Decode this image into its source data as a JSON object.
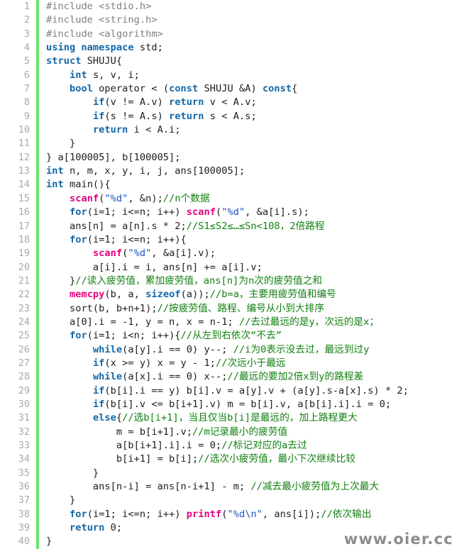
{
  "viewer": {
    "title": "C++ source code listing",
    "language": "C++",
    "total_lines": 40,
    "first_line_number": 1,
    "gutter_marker_color": "#6ae26a",
    "background_color": "#ffffff",
    "line_number_color": "#a9a9a9"
  },
  "theme": {
    "plain": "#202020",
    "preprocessor": "#808080",
    "keyword": "#1367a7",
    "type": "#808080",
    "function": "#e5007f",
    "string": "#1e55c8",
    "comment": "#128012",
    "watermark": "#8c8c8c"
  },
  "watermark": {
    "text": "www.oier.cc"
  },
  "lines": [
    {
      "n": "1",
      "tokens": [
        {
          "t": "pre",
          "x": "#include <stdio.h>"
        }
      ]
    },
    {
      "n": "2",
      "tokens": [
        {
          "t": "pre",
          "x": "#include <string.h>"
        }
      ]
    },
    {
      "n": "3",
      "tokens": [
        {
          "t": "pre",
          "x": "#include <algorithm>"
        }
      ]
    },
    {
      "n": "4",
      "tokens": [
        {
          "t": "kw",
          "x": "using namespace"
        },
        {
          "t": "plain",
          "x": " std;"
        }
      ]
    },
    {
      "n": "5",
      "tokens": [
        {
          "t": "kw",
          "x": "struct"
        },
        {
          "t": "plain",
          "x": " SHUJU{"
        }
      ]
    },
    {
      "n": "6",
      "tokens": [
        {
          "t": "plain",
          "x": "    "
        },
        {
          "t": "kw",
          "x": "int"
        },
        {
          "t": "plain",
          "x": " s, v, i;"
        }
      ]
    },
    {
      "n": "7",
      "tokens": [
        {
          "t": "plain",
          "x": "    "
        },
        {
          "t": "kw",
          "x": "bool"
        },
        {
          "t": "plain",
          "x": " operator < ("
        },
        {
          "t": "kw",
          "x": "const"
        },
        {
          "t": "plain",
          "x": " SHUJU &A) "
        },
        {
          "t": "kw",
          "x": "const"
        },
        {
          "t": "plain",
          "x": "{"
        }
      ]
    },
    {
      "n": "8",
      "tokens": [
        {
          "t": "plain",
          "x": "        "
        },
        {
          "t": "kw",
          "x": "if"
        },
        {
          "t": "plain",
          "x": "(v != A.v) "
        },
        {
          "t": "kw",
          "x": "return"
        },
        {
          "t": "plain",
          "x": " v < A.v;"
        }
      ]
    },
    {
      "n": "9",
      "tokens": [
        {
          "t": "plain",
          "x": "        "
        },
        {
          "t": "kw",
          "x": "if"
        },
        {
          "t": "plain",
          "x": "(s != A.s) "
        },
        {
          "t": "kw",
          "x": "return"
        },
        {
          "t": "plain",
          "x": " s < A.s;"
        }
      ]
    },
    {
      "n": "10",
      "tokens": [
        {
          "t": "plain",
          "x": "        "
        },
        {
          "t": "kw",
          "x": "return"
        },
        {
          "t": "plain",
          "x": " i < A.i;"
        }
      ]
    },
    {
      "n": "11",
      "tokens": [
        {
          "t": "plain",
          "x": "    }"
        }
      ]
    },
    {
      "n": "12",
      "tokens": [
        {
          "t": "plain",
          "x": "} a[100005], b[100005];"
        }
      ]
    },
    {
      "n": "13",
      "tokens": [
        {
          "t": "kw",
          "x": "int"
        },
        {
          "t": "plain",
          "x": " n, m, x, y, i, j, ans[100005];"
        }
      ]
    },
    {
      "n": "14",
      "tokens": [
        {
          "t": "kw",
          "x": "int"
        },
        {
          "t": "plain",
          "x": " main(){"
        }
      ]
    },
    {
      "n": "15",
      "tokens": [
        {
          "t": "plain",
          "x": "    "
        },
        {
          "t": "fn",
          "x": "scanf"
        },
        {
          "t": "plain",
          "x": "("
        },
        {
          "t": "str",
          "x": "\"%d\""
        },
        {
          "t": "plain",
          "x": ", &n);"
        },
        {
          "t": "com",
          "x": "//n个数据"
        }
      ]
    },
    {
      "n": "16",
      "tokens": [
        {
          "t": "plain",
          "x": "    "
        },
        {
          "t": "kw",
          "x": "for"
        },
        {
          "t": "plain",
          "x": "(i=1; i<=n; i++) "
        },
        {
          "t": "fn",
          "x": "scanf"
        },
        {
          "t": "plain",
          "x": "("
        },
        {
          "t": "str",
          "x": "\"%d\""
        },
        {
          "t": "plain",
          "x": ", &a[i].s);"
        }
      ]
    },
    {
      "n": "17",
      "tokens": [
        {
          "t": "plain",
          "x": "    ans[n] = a[n].s * 2;"
        },
        {
          "t": "com",
          "x": "//S1≤S2≤…≤Sn<108，2倍路程"
        }
      ]
    },
    {
      "n": "18",
      "tokens": [
        {
          "t": "plain",
          "x": "    "
        },
        {
          "t": "kw",
          "x": "for"
        },
        {
          "t": "plain",
          "x": "(i=1; i<=n; i++){"
        }
      ]
    },
    {
      "n": "19",
      "tokens": [
        {
          "t": "plain",
          "x": "        "
        },
        {
          "t": "fn",
          "x": "scanf"
        },
        {
          "t": "plain",
          "x": "("
        },
        {
          "t": "str",
          "x": "\"%d\""
        },
        {
          "t": "plain",
          "x": ", &a[i].v);"
        }
      ]
    },
    {
      "n": "20",
      "tokens": [
        {
          "t": "plain",
          "x": "        a[i].i = i, ans[n] += a[i].v;"
        }
      ]
    },
    {
      "n": "21",
      "tokens": [
        {
          "t": "plain",
          "x": "    }"
        },
        {
          "t": "com",
          "x": "//读入疲劳值，累加疲劳值，ans[n]为n次的疲劳值之和"
        }
      ]
    },
    {
      "n": "22",
      "tokens": [
        {
          "t": "plain",
          "x": "    "
        },
        {
          "t": "fn",
          "x": "memcpy"
        },
        {
          "t": "plain",
          "x": "(b, a, "
        },
        {
          "t": "kw",
          "x": "sizeof"
        },
        {
          "t": "plain",
          "x": "(a));"
        },
        {
          "t": "com",
          "x": "//b=a，主要用疲劳值和编号"
        }
      ]
    },
    {
      "n": "23",
      "tokens": [
        {
          "t": "plain",
          "x": "    sort(b, b+n+1);"
        },
        {
          "t": "com",
          "x": "//按疲劳值、路程、编号从小到大排序"
        }
      ]
    },
    {
      "n": "24",
      "tokens": [
        {
          "t": "plain",
          "x": "    a[0].i = -1, y = n, x = n-1; "
        },
        {
          "t": "com",
          "x": "//去过最远的是y，次远的是x；"
        }
      ]
    },
    {
      "n": "25",
      "tokens": [
        {
          "t": "plain",
          "x": "    "
        },
        {
          "t": "kw",
          "x": "for"
        },
        {
          "t": "plain",
          "x": "(i=1; i<n; i++){"
        },
        {
          "t": "com",
          "x": "//从左到右依次“不去”"
        }
      ]
    },
    {
      "n": "26",
      "tokens": [
        {
          "t": "plain",
          "x": "        "
        },
        {
          "t": "kw",
          "x": "while"
        },
        {
          "t": "plain",
          "x": "(a[y].i == 0) y--; "
        },
        {
          "t": "com",
          "x": "//i为0表示没去过，最远到过y"
        }
      ]
    },
    {
      "n": "27",
      "tokens": [
        {
          "t": "plain",
          "x": "        "
        },
        {
          "t": "kw",
          "x": "if"
        },
        {
          "t": "plain",
          "x": "(x >= y) x = y - 1;"
        },
        {
          "t": "com",
          "x": "//次远小于最远"
        }
      ]
    },
    {
      "n": "28",
      "tokens": [
        {
          "t": "plain",
          "x": "        "
        },
        {
          "t": "kw",
          "x": "while"
        },
        {
          "t": "plain",
          "x": "(a[x].i == 0) x--;"
        },
        {
          "t": "com",
          "x": "//最远的要加2倍x到y的路程差"
        }
      ]
    },
    {
      "n": "29",
      "tokens": [
        {
          "t": "plain",
          "x": "        "
        },
        {
          "t": "kw",
          "x": "if"
        },
        {
          "t": "plain",
          "x": "(b[i].i == y) b[i].v = a[y].v + (a[y].s-a[x].s) * 2;"
        }
      ]
    },
    {
      "n": "30",
      "tokens": [
        {
          "t": "plain",
          "x": "        "
        },
        {
          "t": "kw",
          "x": "if"
        },
        {
          "t": "plain",
          "x": "(b[i].v <= b[i+1].v) m = b[i].v, a[b[i].i].i = 0;"
        }
      ]
    },
    {
      "n": "31",
      "tokens": [
        {
          "t": "plain",
          "x": "        "
        },
        {
          "t": "kw",
          "x": "else"
        },
        {
          "t": "plain",
          "x": "{"
        },
        {
          "t": "com",
          "x": "//选b[i+1]，当且仅当b[i]是最远的，加上路程更大"
        }
      ]
    },
    {
      "n": "32",
      "tokens": [
        {
          "t": "plain",
          "x": "            m = b[i+1].v;"
        },
        {
          "t": "com",
          "x": "//m记录最小的疲劳值"
        }
      ]
    },
    {
      "n": "33",
      "tokens": [
        {
          "t": "plain",
          "x": "            a[b[i+1].i].i = 0;"
        },
        {
          "t": "com",
          "x": "//标记对应的a去过"
        }
      ]
    },
    {
      "n": "34",
      "tokens": [
        {
          "t": "plain",
          "x": "            b[i+1] = b[i];"
        },
        {
          "t": "com",
          "x": "//选次小疲劳值，最小下次继续比较"
        }
      ]
    },
    {
      "n": "35",
      "tokens": [
        {
          "t": "plain",
          "x": "        }"
        }
      ]
    },
    {
      "n": "36",
      "tokens": [
        {
          "t": "plain",
          "x": "        ans[n-i] = ans[n-i+1] - m; "
        },
        {
          "t": "com",
          "x": "//减去最小疲劳值为上次最大"
        }
      ]
    },
    {
      "n": "37",
      "tokens": [
        {
          "t": "plain",
          "x": "    }"
        }
      ]
    },
    {
      "n": "38",
      "tokens": [
        {
          "t": "plain",
          "x": "    "
        },
        {
          "t": "kw",
          "x": "for"
        },
        {
          "t": "plain",
          "x": "(i=1; i<=n; i++) "
        },
        {
          "t": "fn",
          "x": "printf"
        },
        {
          "t": "plain",
          "x": "("
        },
        {
          "t": "str",
          "x": "\"%d\\n\""
        },
        {
          "t": "plain",
          "x": ", ans[i]);"
        },
        {
          "t": "com",
          "x": "//依次输出"
        }
      ]
    },
    {
      "n": "39",
      "tokens": [
        {
          "t": "plain",
          "x": "    "
        },
        {
          "t": "kw",
          "x": "return"
        },
        {
          "t": "plain",
          "x": " 0;"
        }
      ]
    },
    {
      "n": "40",
      "tokens": [
        {
          "t": "plain",
          "x": "}"
        }
      ]
    }
  ]
}
